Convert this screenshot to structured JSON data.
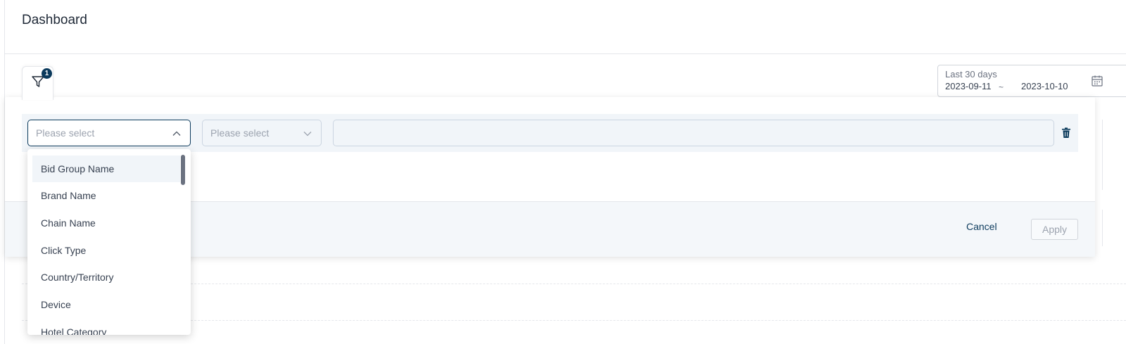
{
  "page": {
    "title": "Dashboard"
  },
  "filter_toggle": {
    "badge": "1",
    "icon": "filter-icon"
  },
  "date_range": {
    "label": "Last 30 days",
    "start": "2023-09-11",
    "separator": "~",
    "end": "2023-10-10",
    "icon": "calendar-icon"
  },
  "filter_row": {
    "field_select": {
      "placeholder": "Please select",
      "icon": "chevron-up-icon"
    },
    "operator_select": {
      "placeholder": "Please select",
      "icon": "chevron-down-icon"
    },
    "delete_icon": "trash-icon"
  },
  "dropdown": {
    "options": [
      "Bid Group Name",
      "Brand Name",
      "Chain Name",
      "Click Type",
      "Country/Territory",
      "Device",
      "Hotel Category"
    ],
    "highlighted": "Bid Group Name"
  },
  "footer": {
    "cancel_label": "Cancel",
    "apply_label": "Apply"
  },
  "colors": {
    "accent": "#0b3a5c",
    "row_background": "#f1f5f9",
    "footer_background": "#f4f7fa"
  }
}
